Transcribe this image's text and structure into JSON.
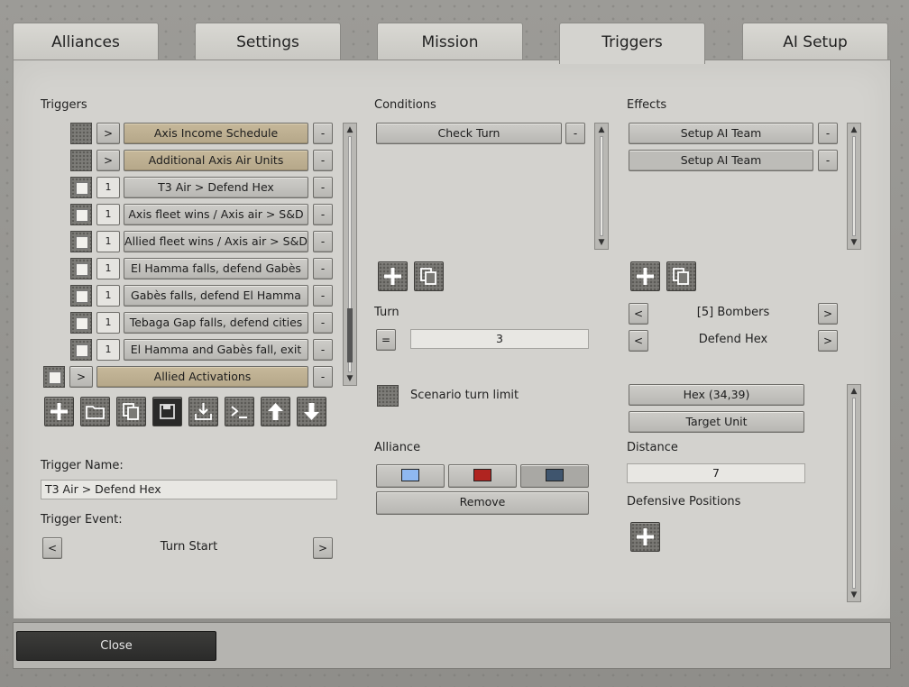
{
  "tabs": [
    {
      "label": "Alliances"
    },
    {
      "label": "Settings"
    },
    {
      "label": "Mission"
    },
    {
      "label": "Triggers",
      "active": true
    },
    {
      "label": "AI Setup"
    }
  ],
  "triggers": {
    "title": "Triggers",
    "items": [
      {
        "label": "Axis Income Schedule",
        "order": ">",
        "style": "tan"
      },
      {
        "label": "Additional Axis Air Units",
        "order": ">",
        "style": "tan"
      },
      {
        "label": "T3 Air > Defend Hex",
        "order": "1",
        "style": "grey"
      },
      {
        "label": "Axis fleet wins / Axis air > S&D",
        "order": "1",
        "style": "grey"
      },
      {
        "label": "Allied fleet wins / Axis air > S&D",
        "order": "1",
        "style": "grey"
      },
      {
        "label": "El Hamma falls, defend Gabès",
        "order": "1",
        "style": "grey"
      },
      {
        "label": "Gabès falls, defend El Hamma",
        "order": "1",
        "style": "grey"
      },
      {
        "label": "Tebaga Gap falls, defend cities",
        "order": "1",
        "style": "grey"
      },
      {
        "label": "El Hamma and Gabès fall, exit",
        "order": "1",
        "style": "grey"
      },
      {
        "label": "Allied Activations",
        "order": ">",
        "style": "tan"
      }
    ],
    "remove_label": "-",
    "toolbar": [
      "add-icon",
      "folder-icon",
      "copy-icon",
      "save-icon",
      "import-icon",
      "console-icon",
      "arrow-up-icon",
      "arrow-down-icon"
    ]
  },
  "trigger_name": {
    "label": "Trigger Name:",
    "value": "T3 Air > Defend Hex"
  },
  "trigger_event": {
    "label": "Trigger Event:",
    "value": "Turn Start",
    "prev": "<",
    "next": ">"
  },
  "conditions": {
    "title": "Conditions",
    "items": [
      {
        "label": "Check Turn"
      }
    ],
    "remove_label": "-"
  },
  "turn": {
    "label": "Turn",
    "operator": "=",
    "value": "3"
  },
  "scenario_turn_limit": {
    "label": "Scenario turn limit"
  },
  "alliance": {
    "label": "Alliance",
    "colors": [
      "#8fb8f0",
      "#b02420",
      "#3f556e"
    ],
    "remove_label": "Remove"
  },
  "effects": {
    "title": "Effects",
    "items": [
      {
        "label": "Setup AI Team"
      },
      {
        "label": "Setup AI Team"
      }
    ],
    "remove_label": "-"
  },
  "effect_params": {
    "bombers": "[5] Bombers",
    "order": "Defend Hex",
    "prev": "<",
    "next": ">"
  },
  "hex_button": "Hex (34,39)",
  "target_unit_button": "Target Unit",
  "distance": {
    "label": "Distance",
    "value": "7"
  },
  "defensive_positions": {
    "label": "Defensive Positions"
  },
  "close_label": "Close"
}
